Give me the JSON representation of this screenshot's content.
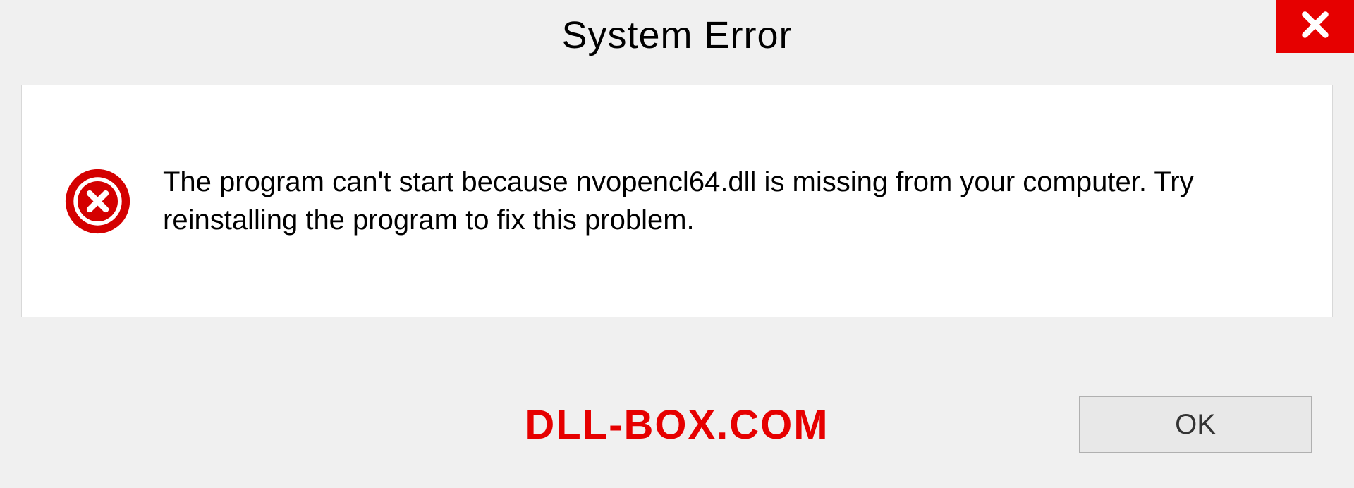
{
  "titlebar": {
    "title": "System Error"
  },
  "dialog": {
    "message": "The program can't start because nvopencl64.dll is missing from your computer. Try reinstalling the program to fix this problem."
  },
  "footer": {
    "watermark": "DLL-BOX.COM",
    "ok_label": "OK"
  }
}
